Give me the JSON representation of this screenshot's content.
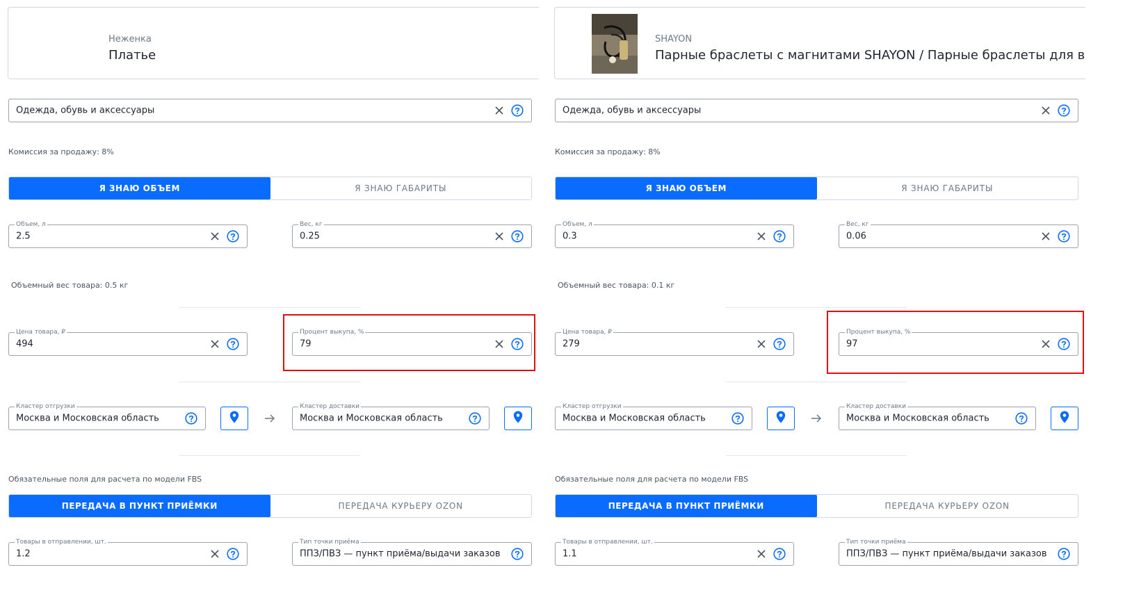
{
  "colors": {
    "accent": "#0a6cff",
    "highlight": "#e01010",
    "border": "#9aa3ae"
  },
  "panels": [
    {
      "product": {
        "brand": "Неженка",
        "name": "Платье"
      },
      "category": {
        "value": "Одежда, обувь и аксессуары"
      },
      "commission": "Комиссия за продажу: 8%",
      "size_toggle": {
        "active": "Я ЗНАЮ ОБЪЕМ",
        "inactive": "Я ЗНАЮ ГАБАРИТЫ"
      },
      "volume": {
        "label": "Объем, л",
        "value": "2.5"
      },
      "weight": {
        "label": "Вес, кг",
        "value": "0.25"
      },
      "volumetric_weight": "Объемный вес товара: 0.5 кг",
      "price": {
        "label": "Цена товара, ₽",
        "value": "494"
      },
      "buyout": {
        "label": "Процент выкупа, %",
        "value": "79"
      },
      "ship_cluster": {
        "label": "Кластер отгрузки",
        "value": "Москва и Московская область"
      },
      "delivery_cluster": {
        "label": "Кластер доставки",
        "value": "Москва и Московская область"
      },
      "fbs_note": "Обязательные поля для расчета по модели FBS",
      "fbs_toggle": {
        "active": "ПЕРЕДАЧА В ПУНКТ ПРИЁМКИ",
        "inactive": "ПЕРЕДАЧА КУРЬЕРУ OZON"
      },
      "items_in_shipment": {
        "label": "Товары в отправлении, шт.",
        "value": "1.2"
      },
      "pickup_point_type": {
        "label": "Тип точки приёма",
        "value": "ППЗ/ПВЗ — пункт приёма/выдачи заказов"
      }
    },
    {
      "product": {
        "brand": "SHAYON",
        "name": "Парные браслеты с магнитами SHAYON / Парные браслеты для влюблё"
      },
      "category": {
        "value": "Одежда, обувь и аксессуары"
      },
      "commission": "Комиссия за продажу: 8%",
      "size_toggle": {
        "active": "Я ЗНАЮ ОБЪЕМ",
        "inactive": "Я ЗНАЮ ГАБАРИТЫ"
      },
      "volume": {
        "label": "Объем, л",
        "value": "0.3"
      },
      "weight": {
        "label": "Вес, кг",
        "value": "0.06"
      },
      "volumetric_weight": "Объемный вес товара: 0.1 кг",
      "price": {
        "label": "Цена товара, ₽",
        "value": "279"
      },
      "buyout": {
        "label": "Процент выкупа, %",
        "value": "97"
      },
      "ship_cluster": {
        "label": "Кластер отгрузки",
        "value": "Москва и Московская область"
      },
      "delivery_cluster": {
        "label": "Кластер доставки",
        "value": "Москва и Московская область"
      },
      "fbs_note": "Обязательные поля для расчета по модели FBS",
      "fbs_toggle": {
        "active": "ПЕРЕДАЧА В ПУНКТ ПРИЁМКИ",
        "inactive": "ПЕРЕДАЧА КУРЬЕРУ OZON"
      },
      "items_in_shipment": {
        "label": "Товары в отправлении, шт.",
        "value": "1.1"
      },
      "pickup_point_type": {
        "label": "Тип точки приёма",
        "value": "ППЗ/ПВЗ — пункт приёма/выдачи заказов"
      }
    }
  ]
}
